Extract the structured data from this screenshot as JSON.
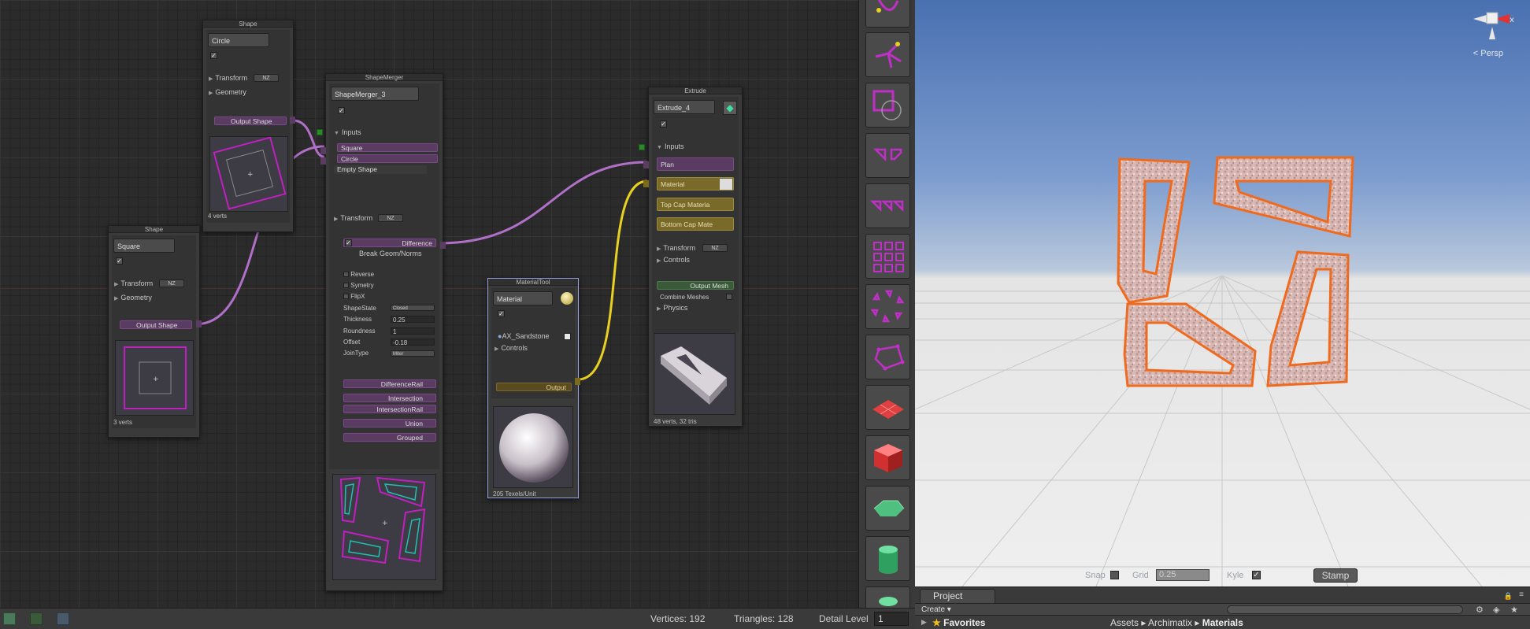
{
  "nodes": {
    "shape_circle": {
      "title": "Shape",
      "name": "Circle",
      "transform_label": "Transform",
      "transform_mode": "NZ",
      "geometry_label": "Geometry",
      "output_label": "Output Shape",
      "verts": "4 verts"
    },
    "shape_square": {
      "title": "Shape",
      "name": "Square",
      "transform_label": "Transform",
      "transform_mode": "NZ",
      "geometry_label": "Geometry",
      "output_label": "Output Shape",
      "verts": "3 verts"
    },
    "shape_merger": {
      "title": "ShapeMerger",
      "name": "ShapeMerger_3",
      "inputs_label": "Inputs",
      "input_square": "Square",
      "input_circle": "Circle",
      "input_empty": "Empty Shape",
      "transform_label": "Transform",
      "transform_mode": "NZ",
      "difference_label": "Difference",
      "break_geom": "Break Geom/Norms",
      "reverse": "Reverse",
      "symetry": "Symetry",
      "flipx": "FlipX",
      "shapestate_label": "ShapeState",
      "shapestate_val": "Closed",
      "thickness_label": "Thickness",
      "thickness_val": "0.25",
      "roundness_label": "Roundness",
      "roundness_val": "1",
      "offset_label": "Offset",
      "offset_val": "-0.18",
      "jointype_label": "JoinType",
      "jointype_val": "Miter",
      "difference_rail": "DifferenceRail",
      "intersection": "Intersection",
      "intersection_rail": "IntersectionRail",
      "union": "Union",
      "grouped": "Grouped"
    },
    "material_tool": {
      "title": "MaterialTool",
      "name": "Material",
      "material_item": "AX_Sandstone",
      "controls_label": "Controls",
      "output_label": "Output",
      "texels": "205 Texels/Unit"
    },
    "extrude": {
      "title": "Extrude",
      "name": "Extrude_4",
      "inputs_label": "Inputs",
      "plan_label": "Plan",
      "material_label": "Material",
      "top_cap_label": "Top Cap Materia",
      "bottom_cap_label": "Bottom Cap Mate",
      "transform_label": "Transform",
      "transform_mode": "NZ",
      "controls_label": "Controls",
      "output_label": "Output Mesh",
      "combine_label": "Combine Meshes",
      "physics_label": "Physics",
      "stats": "48 verts, 32 tris"
    }
  },
  "toolbar": {
    "tools": [
      "path-tool-icon",
      "branch-tool-icon",
      "shape-tool-icon",
      "split-tool-icon",
      "repeat-tool-icon",
      "grid-repeat-tool-icon",
      "radial-tool-icon",
      "polygon-tool-icon",
      "plane-tool-icon",
      "cube-tool-icon",
      "lofted-tool-icon",
      "cylinder-tool-icon",
      "dome-tool-icon"
    ]
  },
  "viewport": {
    "persp_label": "Persp",
    "axis_x": "x",
    "snap_label": "Snap",
    "grid_label": "Grid",
    "grid_value": "0.25",
    "kyle_label": "Kyle",
    "stamp_label": "Stamp"
  },
  "project": {
    "tab_label": "Project",
    "create_label": "Create",
    "favorites_label": "Favorites",
    "crumb_assets": "Assets",
    "crumb_archimatix": "Archimatix",
    "crumb_materials": "Materials"
  },
  "status": {
    "vertices": "Vertices: 192",
    "triangles": "Triangles: 128",
    "detail_label": "Detail Level",
    "detail_value": "1"
  },
  "colors": {
    "shape_port": "#5a3c62",
    "material_port": "#7a6a2a",
    "wire_purple": "#b070c8",
    "wire_yellow": "#e8d020",
    "selection_orange": "#f07020"
  }
}
